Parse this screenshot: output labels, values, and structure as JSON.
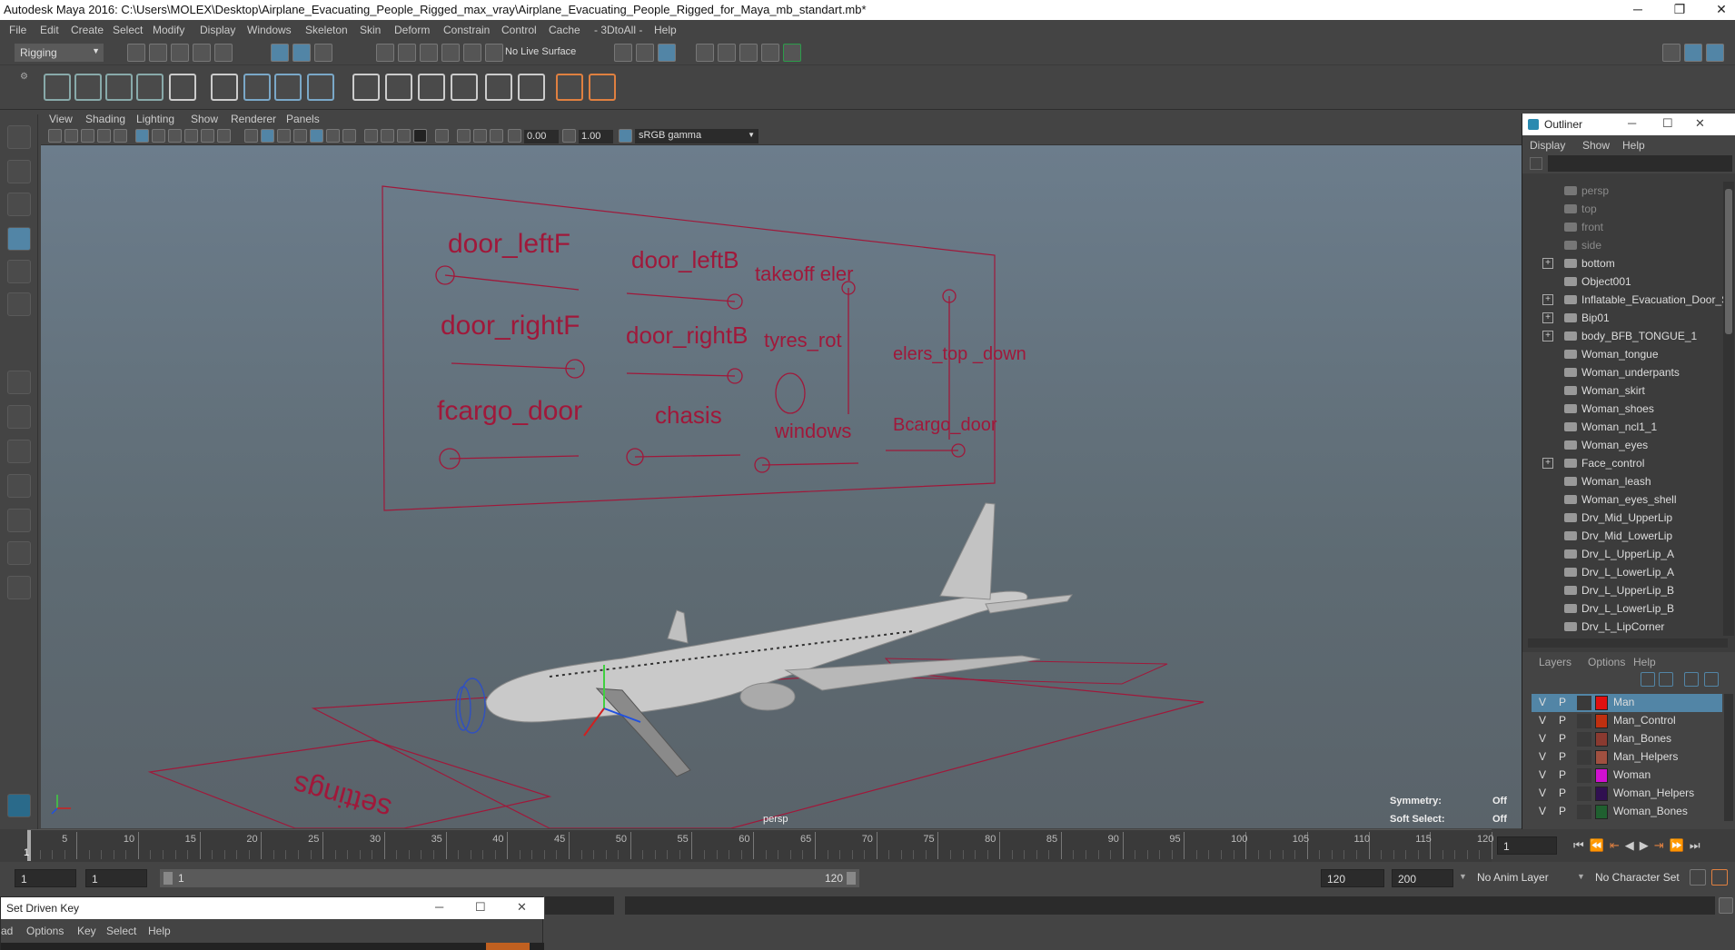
{
  "window": {
    "title": "Autodesk Maya 2016: C:\\Users\\MOLEX\\Desktop\\Airplane_Evacuating_People_Rigged_max_vray\\Airplane_Evacuating_People_Rigged_for_Maya_mb_standart.mb*",
    "minimize": "─",
    "restore": "❐",
    "close": "✕"
  },
  "menubar": [
    "File",
    "Edit",
    "Create",
    "Select",
    "Modify",
    "Display",
    "Windows",
    "Skeleton",
    "Skin",
    "Deform",
    "Constrain",
    "Control",
    "Cache",
    "- 3DtoAll -",
    "Help"
  ],
  "statusline": {
    "mode": "Rigging",
    "live_surface": "No Live Surface"
  },
  "viewport": {
    "menu": [
      "View",
      "Shading",
      "Lighting",
      "Show",
      "Renderer",
      "Panels"
    ],
    "exposure": "0.00",
    "gamma": "1.00",
    "color_space": "sRGB gamma",
    "camera_label": "persp",
    "symmetry_label": "Symmetry:",
    "symmetry_value": "Off",
    "soft_select_label": "Soft Select:",
    "soft_select_value": "Off",
    "panel_labels": [
      "door_leftF",
      "door_leftB",
      "takeoff eler",
      "door_rightF",
      "door_rightB",
      "tyres_rot",
      "elers_top _down",
      "fcargo_door",
      "chasis",
      "windows",
      "Bcargo_door"
    ],
    "ground_label": "settings"
  },
  "outliner": {
    "title": "Outliner",
    "menu": [
      "Display",
      "Show",
      "Help"
    ],
    "items": [
      {
        "label": "persp",
        "expand": false,
        "dim": true
      },
      {
        "label": "top",
        "expand": false,
        "dim": true
      },
      {
        "label": "front",
        "expand": false,
        "dim": true
      },
      {
        "label": "side",
        "expand": false,
        "dim": true
      },
      {
        "label": "bottom",
        "expand": true,
        "dim": false
      },
      {
        "label": "Object001",
        "expand": false,
        "dim": false
      },
      {
        "label": "Inflatable_Evacuation_Door_S",
        "expand": true,
        "dim": false
      },
      {
        "label": "Bip01",
        "expand": true,
        "dim": false
      },
      {
        "label": "body_BFB_TONGUE_1",
        "expand": true,
        "dim": false
      },
      {
        "label": "Woman_tongue",
        "expand": false,
        "dim": false
      },
      {
        "label": "Woman_underpants",
        "expand": false,
        "dim": false
      },
      {
        "label": "Woman_skirt",
        "expand": false,
        "dim": false
      },
      {
        "label": "Woman_shoes",
        "expand": false,
        "dim": false
      },
      {
        "label": "Woman_ncl1_1",
        "expand": false,
        "dim": false
      },
      {
        "label": "Woman_eyes",
        "expand": false,
        "dim": false
      },
      {
        "label": "Face_control",
        "expand": true,
        "dim": false
      },
      {
        "label": "Woman_leash",
        "expand": false,
        "dim": false
      },
      {
        "label": "Woman_eyes_shell",
        "expand": false,
        "dim": false
      },
      {
        "label": "Drv_Mid_UpperLip",
        "expand": false,
        "dim": false
      },
      {
        "label": "Drv_Mid_LowerLip",
        "expand": false,
        "dim": false
      },
      {
        "label": "Drv_L_UpperLip_A",
        "expand": false,
        "dim": false
      },
      {
        "label": "Drv_L_LowerLip_A",
        "expand": false,
        "dim": false
      },
      {
        "label": "Drv_L_UpperLip_B",
        "expand": false,
        "dim": false
      },
      {
        "label": "Drv_L_LowerLip_B",
        "expand": false,
        "dim": false
      },
      {
        "label": "Drv_L_LipCorner",
        "expand": false,
        "dim": false
      }
    ]
  },
  "layers": {
    "menu": [
      "Layers",
      "Options",
      "Help"
    ],
    "rows": [
      {
        "v": "V",
        "p": "P",
        "color": "#e01010",
        "name": "Man",
        "selected": true
      },
      {
        "v": "V",
        "p": "P",
        "color": "#c03010",
        "name": "Man_Control",
        "selected": false
      },
      {
        "v": "V",
        "p": "P",
        "color": "#8a3a30",
        "name": "Man_Bones",
        "selected": false
      },
      {
        "v": "V",
        "p": "P",
        "color": "#a05040",
        "name": "Man_Helpers",
        "selected": false
      },
      {
        "v": "V",
        "p": "P",
        "color": "#d010d0",
        "name": "Woman",
        "selected": false
      },
      {
        "v": "V",
        "p": "P",
        "color": "#301050",
        "name": "Woman_Helpers",
        "selected": false
      },
      {
        "v": "V",
        "p": "P",
        "color": "#206030",
        "name": "Woman_Bones",
        "selected": false
      }
    ]
  },
  "timeline": {
    "ticks": [
      "5",
      "10",
      "15",
      "20",
      "25",
      "30",
      "35",
      "40",
      "45",
      "50",
      "55",
      "60",
      "65",
      "70",
      "75",
      "80",
      "85",
      "90",
      "95",
      "100",
      "105",
      "110",
      "115",
      "120"
    ],
    "start_tick": "1",
    "current_frame": "1"
  },
  "range": {
    "start": "1",
    "playback_start": "1",
    "slider_start": "1",
    "slider_end": "120",
    "playback_end": "120",
    "end": "200",
    "anim_layer": "No Anim Layer",
    "character_set": "No Character Set"
  },
  "set_driven_key": {
    "title": "Set Driven Key",
    "menu": [
      "ad",
      "Options",
      "Key",
      "Select",
      "Help"
    ]
  },
  "colors": {
    "accent": "#5285a6",
    "rig_lines": "#a0183a"
  }
}
